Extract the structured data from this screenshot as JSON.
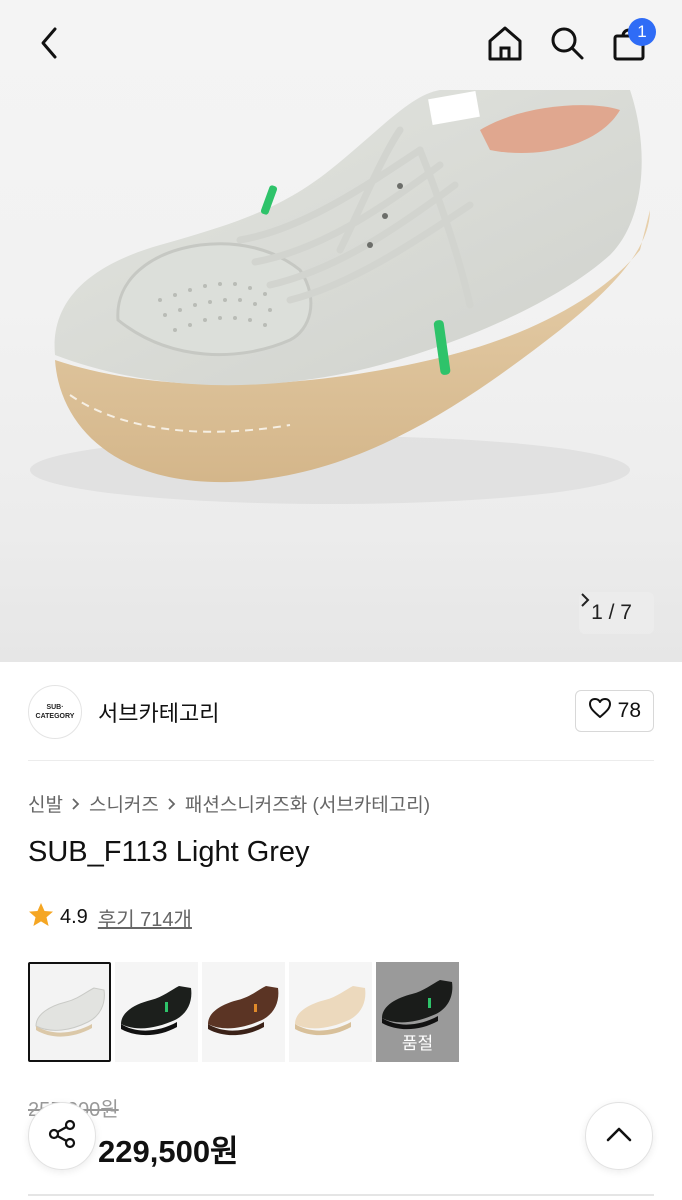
{
  "header": {
    "cart_count": "1",
    "icons": [
      "chevron-left-icon",
      "home-icon",
      "search-icon",
      "shopping-bag-icon"
    ],
    "badge_color": "#2f6cf6"
  },
  "gallery": {
    "counter": "1 / 7"
  },
  "brand": {
    "logo_line1": "SUB·",
    "logo_line2": "CATEGORY",
    "name": "서브카테고리",
    "likes": "78"
  },
  "breadcrumb": [
    "신발",
    "스니커즈",
    "패션스니커즈화 (서브카테고리)"
  ],
  "product": {
    "title": "SUB_F113 Light Grey",
    "rating": "4.9",
    "reviews": "후기 714개",
    "star_color": "#f5a623"
  },
  "variants": [
    {
      "color": "light-grey",
      "selected": true,
      "sold_out": false
    },
    {
      "color": "black",
      "selected": false,
      "sold_out": false
    },
    {
      "color": "brown",
      "selected": false,
      "sold_out": false
    },
    {
      "color": "beige",
      "selected": false,
      "sold_out": false
    },
    {
      "color": "black-green",
      "selected": false,
      "sold_out": true,
      "label": "품절"
    }
  ],
  "price": {
    "original": "255,000원",
    "sale": "229,500원"
  }
}
